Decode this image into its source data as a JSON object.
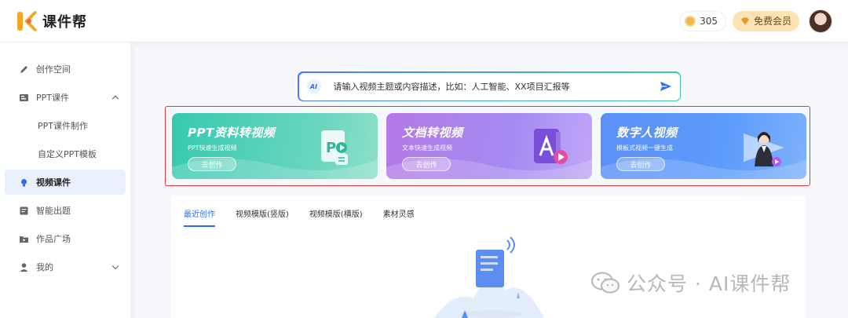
{
  "header": {
    "logo_text": "课件帮",
    "coins": "305",
    "vip_label": "免费会员"
  },
  "sidebar": {
    "items": [
      {
        "label": "创作空间",
        "icon": "pen-icon"
      },
      {
        "label": "PPT课件",
        "icon": "ppt-icon",
        "expanded": true
      },
      {
        "label": "PPT课件制作"
      },
      {
        "label": "自定义PPT模板"
      },
      {
        "label": "视频课件",
        "icon": "video-bulb-icon",
        "active": true
      },
      {
        "label": "智能出题",
        "icon": "quiz-icon"
      },
      {
        "label": "作品广场",
        "icon": "folder-icon"
      },
      {
        "label": "我的",
        "icon": "user-icon",
        "expanded": false
      }
    ]
  },
  "search": {
    "badge": "AI",
    "text": "请输入视频主题或内容描述，比如：人工智能、XX项目汇报等"
  },
  "cards": [
    {
      "title": "PPT资料转视频",
      "subtitle": "PPT快速生成视频",
      "button": "去创作"
    },
    {
      "title": "文档转视频",
      "subtitle": "文本快速生成视频",
      "button": "去创作"
    },
    {
      "title": "数字人视频",
      "subtitle": "模板式视频一键生成",
      "button": "去创作"
    }
  ],
  "tabs": [
    {
      "label": "最近创作",
      "active": true
    },
    {
      "label": "视频模版(竖版)"
    },
    {
      "label": "视频模版(横版)"
    },
    {
      "label": "素材灵感"
    }
  ],
  "watermark": "公众号 · AI课件帮",
  "colors": {
    "accent": "#2f6ef0",
    "highlight": "#e53935",
    "card1": "#37c9b0",
    "card2": "#b479e6",
    "card3": "#5b8ff6"
  }
}
